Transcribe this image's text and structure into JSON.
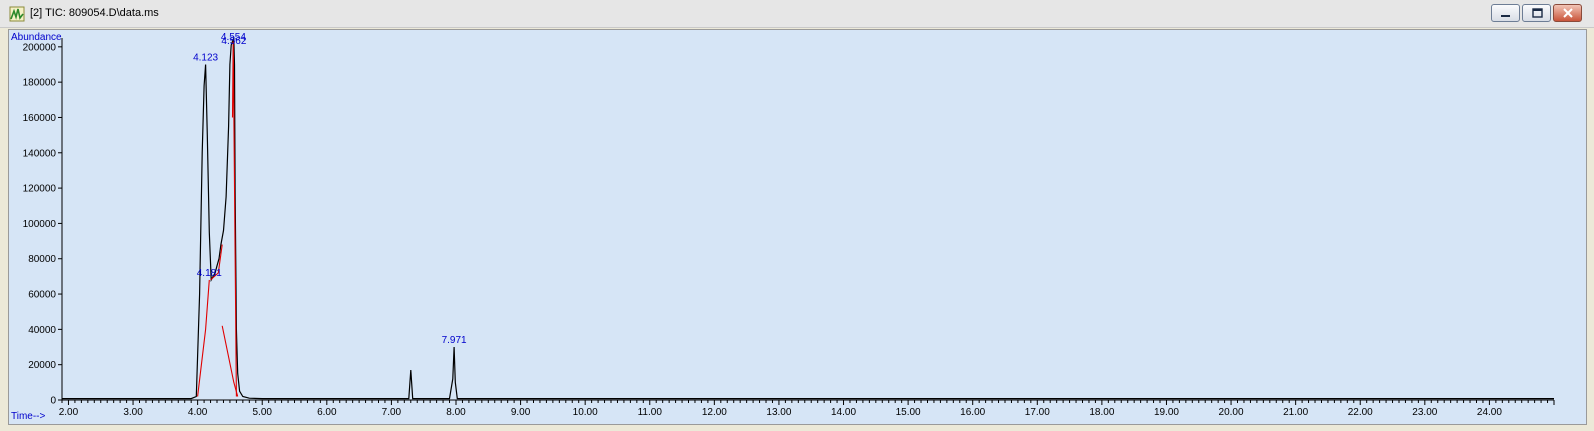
{
  "window": {
    "title": "[2] TIC: 809054.D\\data.ms",
    "icon": "chromatogram-icon",
    "controls": [
      "minimize-icon",
      "restore-icon",
      "close-icon"
    ]
  },
  "colors": {
    "plot_background": "#d6e5f6",
    "trace": "#000000",
    "integration": "#e00000",
    "labels": "#0000cc"
  },
  "chart_data": {
    "type": "line",
    "title": "",
    "ylabel": "Abundance",
    "xlabel": "Time-->",
    "xlim": [
      1.9,
      25.0
    ],
    "ylim": [
      0,
      205000
    ],
    "x_ticks": [
      2,
      3,
      4,
      5,
      6,
      7,
      8,
      9,
      10,
      11,
      12,
      13,
      14,
      15,
      16,
      17,
      18,
      19,
      20,
      21,
      22,
      23,
      24
    ],
    "x_tick_labels": [
      "2.00",
      "3.00",
      "4.00",
      "5.00",
      "6.00",
      "7.00",
      "8.00",
      "9.00",
      "10.00",
      "11.00",
      "12.00",
      "13.00",
      "14.00",
      "15.00",
      "16.00",
      "17.00",
      "18.00",
      "19.00",
      "20.00",
      "21.00",
      "22.00",
      "23.00",
      "24.00"
    ],
    "y_ticks": [
      0,
      20000,
      40000,
      60000,
      80000,
      100000,
      120000,
      140000,
      160000,
      180000,
      200000
    ],
    "y_tick_labels": [
      "0",
      "20000",
      "40000",
      "60000",
      "80000",
      "100000",
      "120000",
      "140000",
      "160000",
      "180000",
      "200000"
    ],
    "series": [
      {
        "x": [
          1.9,
          3.9,
          3.98,
          4.03,
          4.07,
          4.1,
          4.123,
          4.15,
          4.18,
          4.21,
          4.24,
          4.27,
          4.3,
          4.33,
          4.36,
          4.4,
          4.44,
          4.48,
          4.5,
          4.52,
          4.54,
          4.56,
          4.57,
          4.58,
          4.6,
          4.62,
          4.65,
          4.7,
          4.8,
          5.0,
          7.27,
          7.3,
          7.33,
          7.36,
          7.9,
          7.95,
          7.971,
          7.99,
          8.02,
          25.0
        ],
        "y": [
          800,
          800,
          2000,
          60000,
          140000,
          178000,
          190000,
          150000,
          95000,
          68000,
          70000,
          72000,
          76000,
          80000,
          88000,
          96000,
          115000,
          155000,
          190000,
          201000,
          203000,
          205000,
          190000,
          120000,
          40000,
          15000,
          5000,
          2000,
          1000,
          800,
          800,
          17000,
          800,
          800,
          800,
          12000,
          30000,
          10000,
          800,
          800
        ]
      }
    ],
    "integration_baselines": [
      {
        "x": [
          4.0,
          4.123,
          4.18
        ],
        "y": [
          2000,
          40000,
          68000
        ]
      },
      {
        "x": [
          4.2,
          4.32,
          4.38
        ],
        "y": [
          68000,
          72000,
          88000
        ]
      },
      {
        "x": [
          4.38,
          4.56,
          4.62
        ],
        "y": [
          42000,
          10000,
          2000
        ]
      },
      {
        "x": [
          4.54,
          4.55,
          4.6
        ],
        "y": [
          160000,
          203000,
          2000
        ]
      }
    ],
    "peak_labels": [
      {
        "x": 4.123,
        "y": 190000,
        "text": "4.123"
      },
      {
        "x": 4.18,
        "y": 68000,
        "text": "4.181"
      },
      {
        "x": 4.554,
        "y": 205000,
        "text": "4.554"
      },
      {
        "x": 4.562,
        "y": 202000,
        "text": "4.562"
      },
      {
        "x": 7.971,
        "y": 30000,
        "text": "7.971"
      }
    ]
  }
}
